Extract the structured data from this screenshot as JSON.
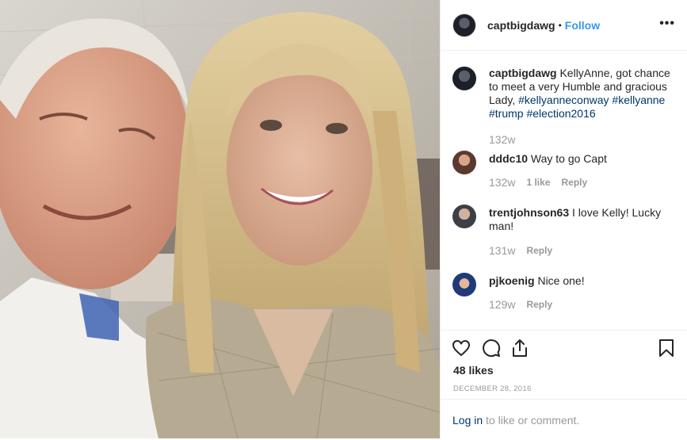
{
  "header": {
    "username": "captbigdawg",
    "separator": "•",
    "follow_label": "Follow",
    "more_label": "•••"
  },
  "caption": {
    "username": "captbigdawg",
    "text": "KellyAnne, got chance to meet a very Humble and gracious Lady,",
    "tags": [
      "#kellyanneconway",
      "#kellyanne",
      "#trump",
      "#election2016"
    ],
    "time": "132w"
  },
  "comments": [
    {
      "username": "dddc10",
      "text": "Way to go Capt",
      "time": "132w",
      "likes": "1 like",
      "reply": "Reply"
    },
    {
      "username": "trentjohnson63",
      "text": "I love Kelly! Lucky man!",
      "time": "131w",
      "reply": "Reply"
    },
    {
      "username": "pjkoenig",
      "text": "Nice one!",
      "time": "129w",
      "reply": "Reply"
    }
  ],
  "actions": {
    "icons": [
      "heart-icon",
      "comment-icon",
      "share-icon",
      "bookmark-icon"
    ],
    "likes": "48 likes",
    "date": "DECEMBER 28, 2016"
  },
  "login_bar": {
    "login_label": "Log in",
    "rest": "to like or comment."
  },
  "colors": {
    "link_blue": "#3897f0",
    "tag_blue": "#003569",
    "muted": "#999999",
    "divider": "#efefef"
  }
}
